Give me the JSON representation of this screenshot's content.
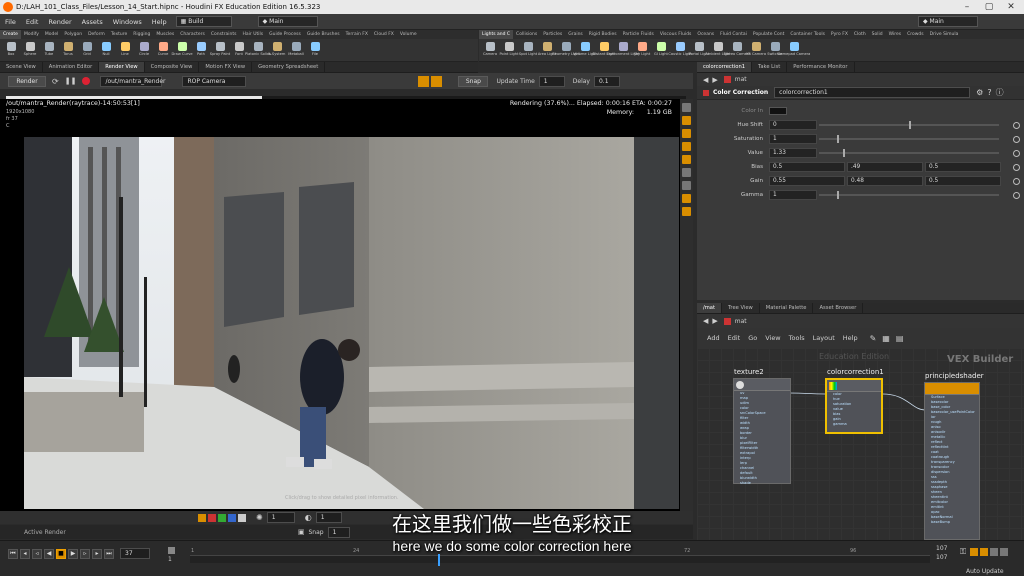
{
  "window": {
    "title": "D:/LAH_101_Class_Files/Lesson_14_Start.hipnc - Houdini FX Education Edition 16.5.323"
  },
  "menu": {
    "items": [
      "File",
      "Edit",
      "Render",
      "Assets",
      "Windows",
      "Help"
    ],
    "desktop_value": "Build",
    "context_value": "Main",
    "right_context_value": "Main"
  },
  "shelf_left": {
    "tabs": [
      "Create",
      "Modify",
      "Model",
      "Polygon",
      "Deform",
      "Texture",
      "Rigging",
      "Muscles",
      "Characters",
      "Constraints",
      "Hair Utils",
      "Guide Process",
      "Guide Brushes",
      "Terrain FX",
      "Cloud FX",
      "Volume"
    ],
    "tools": [
      "Box",
      "Sphere",
      "Tube",
      "Torus",
      "Grid",
      "Null",
      "Line",
      "Circle",
      "Curve",
      "Draw Curve",
      "Path",
      "Spray Paint",
      "Font",
      "Platonic Solids",
      "L-System",
      "Metaball",
      "File"
    ]
  },
  "shelf_right": {
    "tabs": [
      "Lights and C",
      "Collisions",
      "Particles",
      "Grains",
      "Rigid Bodies",
      "Particle Fluids",
      "Viscous Fluids",
      "Oceans",
      "Fluid Contai",
      "Populate Cont",
      "Container Tools",
      "Pyro FX",
      "Cloth",
      "Solid",
      "Wires",
      "Crowds",
      "Drive Simula"
    ],
    "tools": [
      "Camera",
      "Point Light",
      "Spot Light",
      "Area Light",
      "Geometry Light",
      "Volume Light",
      "Distant Light",
      "Environment Light",
      "Sky Light",
      "GI Light",
      "Caustic Light",
      "Portal Light",
      "Ambient Light",
      "Stereo Camera",
      "VR Camera",
      "Switcher",
      "Gamepad Camera"
    ]
  },
  "left_pane_tabs": [
    "Scene View",
    "Animation Editor",
    "Render View",
    "Composite View",
    "Motion FX View",
    "Geometry Spreadsheet"
  ],
  "render_toolbar": {
    "render_button": "Render",
    "rop_path": "/out/mantra_Render",
    "camera": "ROP Camera",
    "snap": "Snap",
    "update_time_label": "Update Time",
    "update_time_value": "1",
    "delay_label": "Delay",
    "delay_value": "0.1"
  },
  "render_view": {
    "header": "/out/mantra_Render(raytrace)-14:50:53[1]",
    "resolution": "1920x1080",
    "frame": "fr 37",
    "channel": "C",
    "status": "Rendering (37.6%)...  Elapsed: 0:00:16   ETA: 0:00:27",
    "memory_label": "Memory:",
    "memory_value": "1.19 GB",
    "hint": "Click/drag to show detailed pixel information.",
    "progress_fraction": 0.376
  },
  "render_bottom": {
    "zoom_value": "1",
    "frame_value": "1",
    "snap_label": "Snap",
    "snap_value": "1",
    "active_render_tab": "Active Render"
  },
  "params_pane": {
    "tabs": [
      "colorcorrection1",
      "Take List",
      "Performance Monitor"
    ],
    "path": "mat",
    "node_type": "Color Correction",
    "node_name": "colorcorrection1",
    "rows": [
      {
        "label": "Color In",
        "values": []
      },
      {
        "label": "Hue Shift",
        "values": [
          "0"
        ]
      },
      {
        "label": "Saturation",
        "values": [
          "1"
        ]
      },
      {
        "label": "Value",
        "values": [
          "1.33"
        ]
      },
      {
        "label": "Bias",
        "values": [
          "0.5",
          ".49",
          "0.5"
        ]
      },
      {
        "label": "Gain",
        "values": [
          "0.55",
          "0.48",
          "0.5"
        ]
      },
      {
        "label": "Gamma",
        "values": [
          "1"
        ]
      }
    ]
  },
  "network_pane": {
    "tabs": [
      "/mat",
      "Tree View",
      "Material Palette",
      "Asset Browser"
    ],
    "path": "mat",
    "menu": [
      "Add",
      "Edit",
      "Go",
      "View",
      "Tools",
      "Layout",
      "Help"
    ],
    "context_watermark": "Education Edition",
    "builder_label": "VEX Builder",
    "nodes": [
      {
        "name": "texture2",
        "inputs": [
          "uv",
          "map",
          "udim",
          "color",
          "srcColorSpace",
          "filter",
          "width",
          "wrap",
          "border",
          "blur",
          "pixelFilter",
          "filterwidth",
          "extrapol",
          "interp",
          "lerp",
          "channel",
          "default",
          "blurwidth",
          "shade"
        ]
      },
      {
        "name": "colorcorrection1",
        "inputs": [
          "color",
          "hue",
          "saturation",
          "value",
          "bias",
          "gain",
          "gamma"
        ]
      },
      {
        "name": "principledshader",
        "inputs": [
          "Surface",
          "basecolor",
          "base_color",
          "basecolor_usePointColor",
          "ior",
          "rough",
          "aniso",
          "anisodir",
          "metallic",
          "reflect",
          "reflecttint",
          "coat",
          "coatrough",
          "transparency",
          "transcolor",
          "dispersion",
          "sss",
          "sssdepth",
          "sssphase",
          "sheen",
          "sheentint",
          "emitcolor",
          "emitint",
          "opac",
          "baseNormal",
          "baseBump"
        ]
      }
    ]
  },
  "timeline": {
    "current_frame": "37",
    "start_value": "1",
    "marks": [
      "1",
      "24",
      "48",
      "72",
      "96",
      "107"
    ],
    "end_a": "107",
    "end_b": "107",
    "auto_update": "Auto Update"
  },
  "subtitles": {
    "chinese": "在这里我们做一些色彩校正",
    "english": "here we do some color correction here"
  },
  "colors": {
    "accent": "#d98e00",
    "node_selected": "#f0c000",
    "logo": "#ff6a00"
  }
}
